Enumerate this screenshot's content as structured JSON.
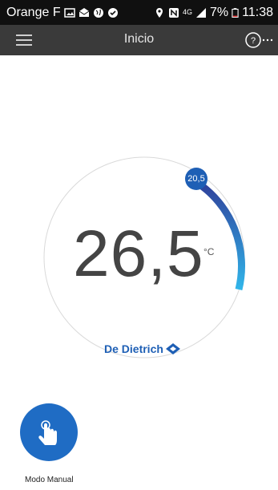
{
  "status_bar": {
    "carrier": "Orange F",
    "network": "4G",
    "battery": "7%",
    "time": "11:38"
  },
  "app_bar": {
    "title": "Inicio",
    "help_glyph": "?"
  },
  "thermostat": {
    "current_temp": "26,5",
    "unit": "°C",
    "setpoint": "20,5",
    "brand": "De Dietrich"
  },
  "mode": {
    "label": "Modo Manual"
  },
  "colors": {
    "accent": "#1f6cc4",
    "arc_dark": "#2f3f9a",
    "arc_light": "#31b6ea"
  },
  "icons": [
    "menu-icon",
    "help-icon",
    "hand-tap-icon",
    "brand-diamond-icon"
  ]
}
